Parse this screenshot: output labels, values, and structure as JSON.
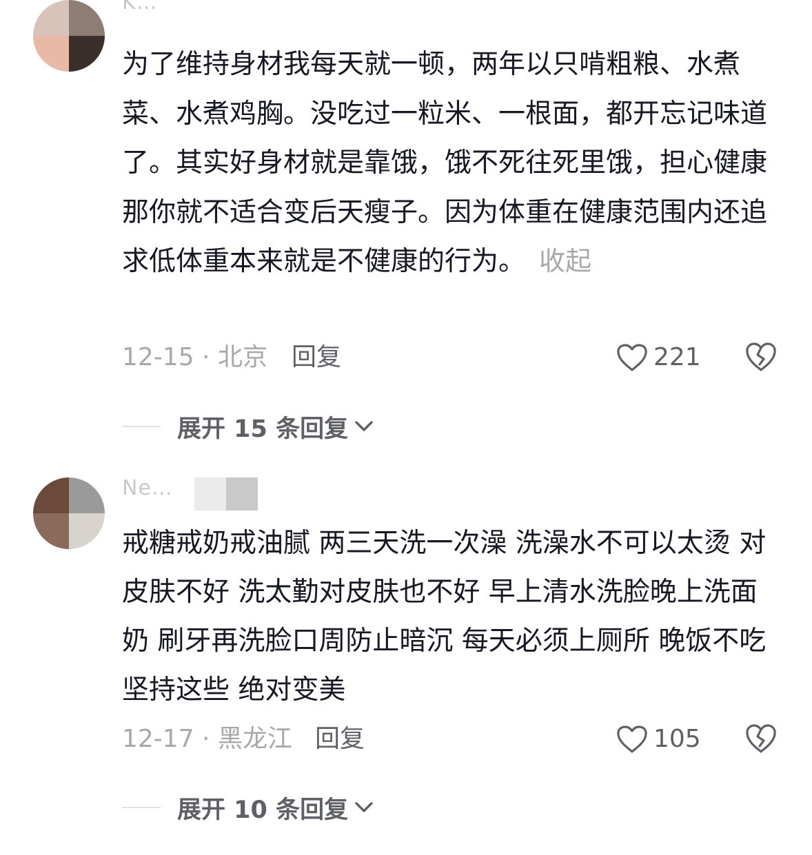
{
  "comments": [
    {
      "username": "K…",
      "text": "为了维持身材我每天就一顿，两年以只啃粗粮、水煮菜、水煮鸡胸。没吃过一粒米、一根面，都开忘记味道了。其实好身材就是靠饿，饿不死往死里饿，担心健康那你就不适合变后天瘦子。因为体重在健康范围内还追求低体重本来就是不健康的行为。",
      "collapse_label": "收起",
      "date_location": "12-15 · 北京",
      "reply_label": "回复",
      "like_count": "221",
      "expand_label": "展开 15 条回复"
    },
    {
      "username": "Ne…",
      "text": "戒糖戒奶戒油腻 两三天洗一次澡 洗澡水不可以太烫 对皮肤不好 洗太勤对皮肤也不好 早上清水洗脸晚上洗面奶 刷牙再洗脸口周防止暗沉 每天必须上厕所 晚饭不吃 坚持这些 绝对变美",
      "date_location": "12-17 · 黑龙江",
      "reply_label": "回复",
      "like_count": "105",
      "expand_label": "展开 10 条回复"
    }
  ],
  "icons": {
    "like": "heart-outline-icon",
    "dislike": "broken-heart-icon",
    "expand": "chevron-down-icon"
  },
  "colors": {
    "primary_text": "#161823",
    "secondary_text": "#a7a8ac",
    "action_text": "#5e6066"
  }
}
